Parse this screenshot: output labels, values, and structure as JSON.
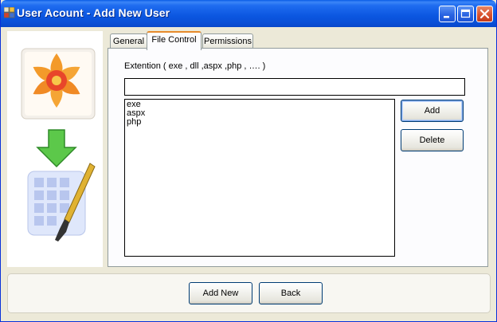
{
  "window": {
    "title": "User Acount - Add New User",
    "controls": [
      "minimize-icon",
      "maximize-icon",
      "close-icon"
    ]
  },
  "tabs": [
    {
      "label": "General",
      "active": false
    },
    {
      "label": "File Control",
      "active": true
    },
    {
      "label": "Permissions",
      "active": false
    }
  ],
  "file_control": {
    "extension_label": "Extention ( exe , dll ,aspx ,php , ….  )",
    "extension_input_value": "",
    "extensions": [
      "exe",
      "aspx",
      "php"
    ],
    "add_label": "Add",
    "delete_label": "Delete"
  },
  "footer": {
    "add_new_label": "Add New",
    "back_label": "Back"
  },
  "images": [
    "flower-logo-icon",
    "download-arrow-icon",
    "paintbrush-grid-icon"
  ],
  "colors": {
    "titlebar": "#0a56e0",
    "window_bg": "#ece9d8",
    "active_tab_accent": "#e68b2c",
    "close_button": "#d9532f"
  }
}
